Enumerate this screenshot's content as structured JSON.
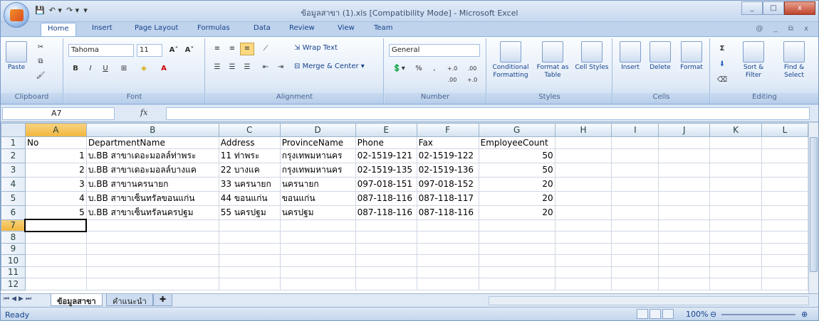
{
  "window": {
    "title": "ข้อมูลสาขา (1).xls  [Compatibility Mode] - Microsoft Excel",
    "min": "_",
    "max": "□",
    "close": "x"
  },
  "qat": {
    "save": "💾",
    "undo": "↶ ▾",
    "redo": "↷ ▾",
    "more": "▾"
  },
  "tabs": [
    "Home",
    "Insert",
    "Page Layout",
    "Formulas",
    "Data",
    "Review",
    "View",
    "Team"
  ],
  "tab_right": "@ _ ⧉ x",
  "ribbon": {
    "clipboard": {
      "paste": "Paste",
      "label": "Clipboard"
    },
    "font": {
      "name": "Tahoma",
      "size": "11",
      "bold": "B",
      "italic": "I",
      "underline": "U",
      "grow": "A˄",
      "shrink": "A˅",
      "color": "A",
      "label": "Font"
    },
    "alignment": {
      "wrap": "Wrap Text",
      "merge": "Merge & Center",
      "label": "Alignment"
    },
    "number": {
      "format": "General",
      "percent": "%",
      "comma": ",",
      "inc": "+.0 .00",
      "dec": ".00 +.0",
      "label": "Number"
    },
    "styles": {
      "cond": "Conditional Formatting",
      "table": "Format as Table",
      "cell": "Cell Styles",
      "label": "Styles"
    },
    "cells": {
      "insert": "Insert",
      "delete": "Delete",
      "format": "Format",
      "label": "Cells"
    },
    "editing": {
      "sum": "Σ",
      "sort": "Sort & Filter",
      "find": "Find & Select",
      "label": "Editing"
    }
  },
  "formula_bar": {
    "name_box": "A7",
    "fx": "fx",
    "content": ""
  },
  "columns": [
    "A",
    "B",
    "C",
    "D",
    "E",
    "F",
    "G",
    "H",
    "I",
    "J",
    "K",
    "L"
  ],
  "rows": [
    [
      "No",
      "DepartmentName",
      "Address",
      "ProvinceName",
      "Phone",
      "Fax",
      "EmployeeCount",
      "",
      "",
      "",
      "",
      ""
    ],
    [
      "1",
      "บ.BB สาขาเดอะมอลล์ท่าพระ",
      "11 ท่าพระ",
      "กรุงเทพมหานคร",
      "02-1519-121",
      "02-1519-122",
      "50",
      "",
      "",
      "",
      "",
      ""
    ],
    [
      "2",
      "บ.BB สาขาเดอะมอลล์บางแค",
      "22 บางแค",
      "กรุงเทพมหานคร",
      "02-1519-135",
      "02-1519-136",
      "50",
      "",
      "",
      "",
      "",
      ""
    ],
    [
      "3",
      "บ.BB สาขานครนายก",
      "33 นครนายก",
      "นครนายก",
      "097-018-151",
      "097-018-152",
      "20",
      "",
      "",
      "",
      "",
      ""
    ],
    [
      "4",
      "บ.BB สาขาเซ็นทรัลขอนแก่น",
      "44 ขอนแก่น",
      "ขอนแก่น",
      "087-118-116",
      "087-118-117",
      "20",
      "",
      "",
      "",
      "",
      ""
    ],
    [
      "5",
      "บ.BB สาขาเซ็นทรัลนครปฐม",
      "55 นครปฐม",
      "นครปฐม",
      "087-118-116",
      "087-118-116",
      "20",
      "",
      "",
      "",
      "",
      ""
    ],
    [
      "",
      "",
      "",
      "",
      "",
      "",
      "",
      "",
      "",
      "",
      "",
      ""
    ],
    [
      "",
      "",
      "",
      "",
      "",
      "",
      "",
      "",
      "",
      "",
      "",
      ""
    ],
    [
      "",
      "",
      "",
      "",
      "",
      "",
      "",
      "",
      "",
      "",
      "",
      ""
    ],
    [
      "",
      "",
      "",
      "",
      "",
      "",
      "",
      "",
      "",
      "",
      "",
      ""
    ],
    [
      "",
      "",
      "",
      "",
      "",
      "",
      "",
      "",
      "",
      "",
      "",
      ""
    ],
    [
      "",
      "",
      "",
      "",
      "",
      "",
      "",
      "",
      "",
      "",
      "",
      ""
    ]
  ],
  "row_numbers": [
    "1",
    "2",
    "3",
    "4",
    "5",
    "6",
    "7",
    "8",
    "9",
    "10",
    "11",
    "12"
  ],
  "sheets": [
    "ข้อมูลสาขา",
    "คำแนะนำ"
  ],
  "status": {
    "text": "Ready",
    "zoom": "100%",
    "minus": "⊖",
    "plus": "⊕"
  }
}
